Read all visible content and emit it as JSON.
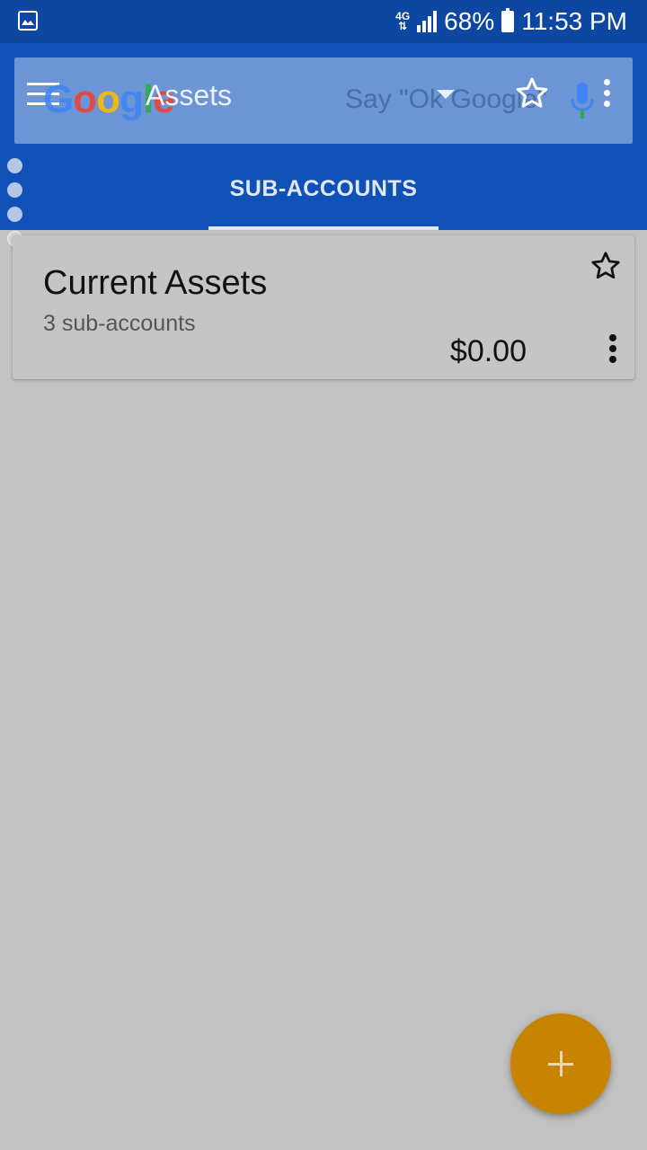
{
  "status_bar": {
    "network": "4G",
    "battery": "68%",
    "time": "11:53 PM"
  },
  "header": {
    "title": "Assets",
    "google_logo": "Google",
    "voice_hint": "Say \"Ok Google\"",
    "tabs": [
      {
        "label": "SUB-ACCOUNTS",
        "active": true
      }
    ]
  },
  "accounts": [
    {
      "name": "Current Assets",
      "subtitle": "3 sub-accounts",
      "balance": "$0.00"
    }
  ],
  "icons": {
    "status_left": "image-icon",
    "menu": "hamburger-menu-icon",
    "favorite": "star-outline-icon",
    "mic": "mic-icon",
    "overflow": "more-vert-icon",
    "fab": "plus-icon"
  },
  "colors": {
    "status_bar": "#0d47a1",
    "app_bar": "#1051b8",
    "background": "#c2c2c2",
    "fab": "#c88400"
  }
}
